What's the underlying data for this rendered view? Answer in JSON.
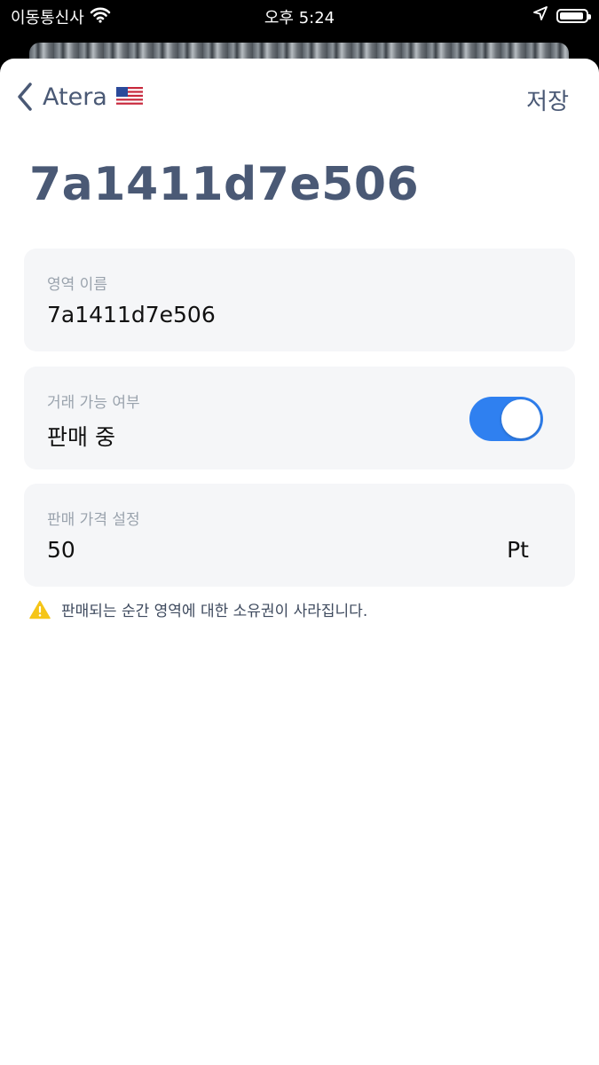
{
  "status_bar": {
    "carrier": "이동통신사",
    "time": "오후 5:24",
    "icons": [
      "wifi-icon",
      "location-arrow-icon",
      "battery-icon"
    ]
  },
  "nav": {
    "back_label": "Atera",
    "back_icon": "chevron-left-icon",
    "flag_icon": "us-flag-icon",
    "save_label": "저장"
  },
  "title": "7a1411d7e506",
  "area_name": {
    "label": "영역 이름",
    "value": "7a1411d7e506"
  },
  "trade_status": {
    "label": "거래 가능 여부",
    "value": "판매 중",
    "toggle_on": true
  },
  "price": {
    "label": "판매 가격 설정",
    "value": "50",
    "unit": "Pt"
  },
  "warning": {
    "icon": "warning-icon",
    "text": "판매되는 순간 영역에 대한 소유권이 사라집니다."
  },
  "colors": {
    "accent": "#2f80f0",
    "title": "#4a5975",
    "card_bg": "#f5f6f8",
    "warning_icon": "#f5c518"
  }
}
